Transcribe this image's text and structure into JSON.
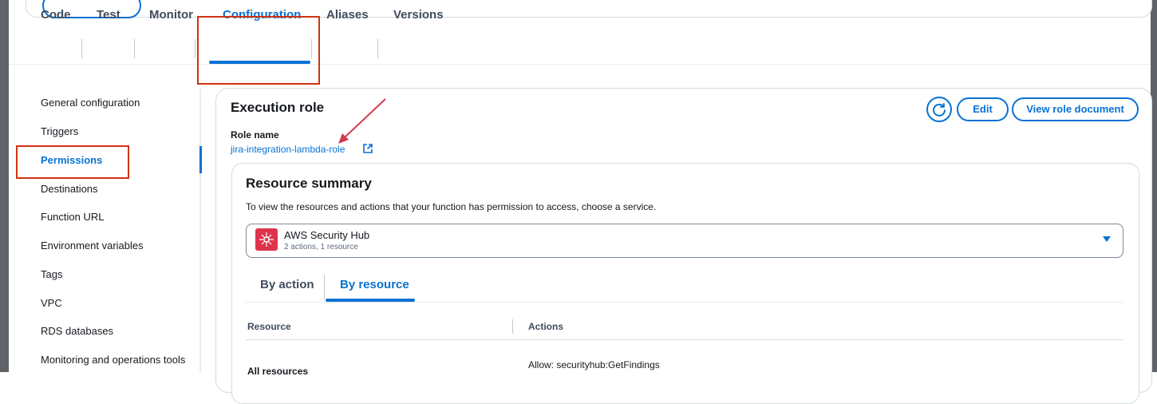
{
  "tabs": [
    "Code",
    "Test",
    "Monitor",
    "Configuration",
    "Aliases",
    "Versions"
  ],
  "nav": {
    "items": [
      "General configuration",
      "Triggers",
      "Permissions",
      "Destinations",
      "Function URL",
      "Environment variables",
      "Tags",
      "VPC",
      "RDS databases",
      "Monitoring and operations tools"
    ],
    "active": "Permissions"
  },
  "execution_role": {
    "title": "Execution role",
    "role_name_label": "Role name",
    "role_name": "jira-integration-lambda-role",
    "edit_label": "Edit",
    "view_doc_label": "View role document"
  },
  "resource_summary": {
    "title": "Resource summary",
    "description": "To view the resources and actions that your function has permission to access, choose a service.",
    "service": {
      "name": "AWS Security Hub",
      "meta": "2 actions, 1 resource"
    },
    "subtabs": [
      "By action",
      "By resource"
    ],
    "active_subtab": "By resource",
    "table": {
      "headers": [
        "Resource",
        "Actions"
      ],
      "rows": [
        {
          "resource": "All resources",
          "action": "Allow: securityhub:GetFindings"
        }
      ]
    }
  },
  "colors": {
    "accent": "#0972d3",
    "highlight": "#d13212",
    "service_icon": "#dd344c"
  }
}
